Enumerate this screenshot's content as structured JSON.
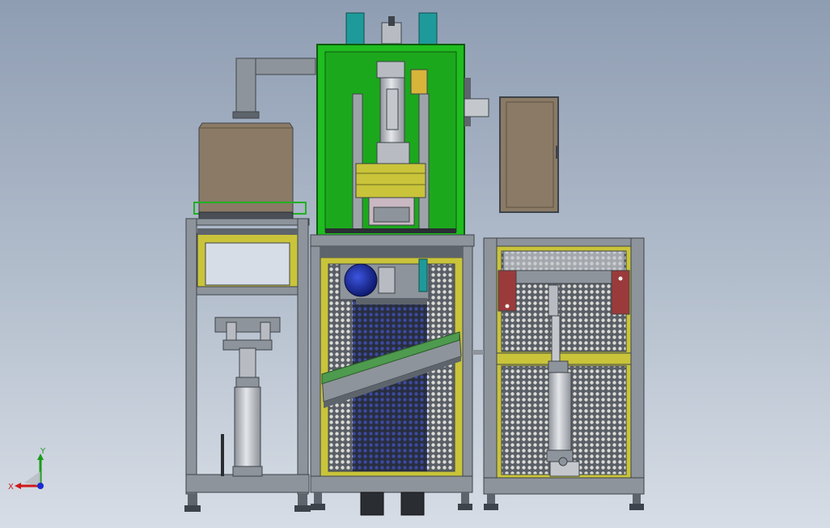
{
  "viewport": {
    "background_top": "#8f9db3",
    "background_bottom": "#d7dde6"
  },
  "triad": {
    "x_label": "X",
    "y_label": "Y",
    "x_color": "#d01818",
    "y_color": "#1a9a1a",
    "z_color": "#1a2ad0"
  },
  "colors": {
    "frame": "#7c8590",
    "frame_dark": "#3d434a",
    "yellow_panel": "#c9c43a",
    "mesh_bg": "#4d525a",
    "green_housing": "#1fbd1f",
    "brown_box": "#8a7a66",
    "teal": "#1f9a9a",
    "blue_motor": "#1d2fa8",
    "cylinder": "#c9ccd1",
    "red_bracket": "#9b3a3a"
  }
}
